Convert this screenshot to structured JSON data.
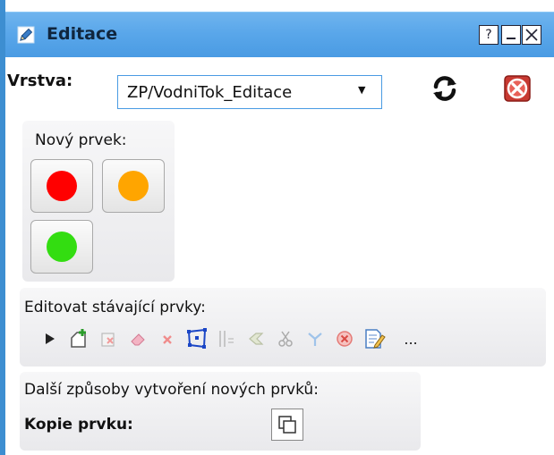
{
  "window": {
    "title": "Editace",
    "help_label": "?"
  },
  "layer": {
    "label": "Vrstva:",
    "selected": "ZP/VodniTok_Editace"
  },
  "new_feature": {
    "title": "Nový prvek:",
    "buttons": [
      {
        "color": "#ff0000"
      },
      {
        "color": "#ffa500"
      },
      {
        "color": "#33dd11"
      }
    ]
  },
  "edit_existing": {
    "title": "Editovat stávající prvky:",
    "tools": [
      "select-arrow-icon",
      "add-part-icon",
      "delete-part-icon",
      "eraser-icon",
      "delete-icon",
      "edit-vertices-icon",
      "split-line-icon",
      "reshape-icon",
      "cut-icon",
      "merge-icon",
      "cancel-edit-icon",
      "attributes-icon",
      "more-icon"
    ],
    "more_label": "..."
  },
  "other_ways": {
    "title": "Další způsoby vytvoření nových prvků:",
    "copy_label": "Kopie prvku:"
  },
  "colors": {
    "accent": "#4a9be3",
    "titlebar": "#5aa7ea"
  }
}
